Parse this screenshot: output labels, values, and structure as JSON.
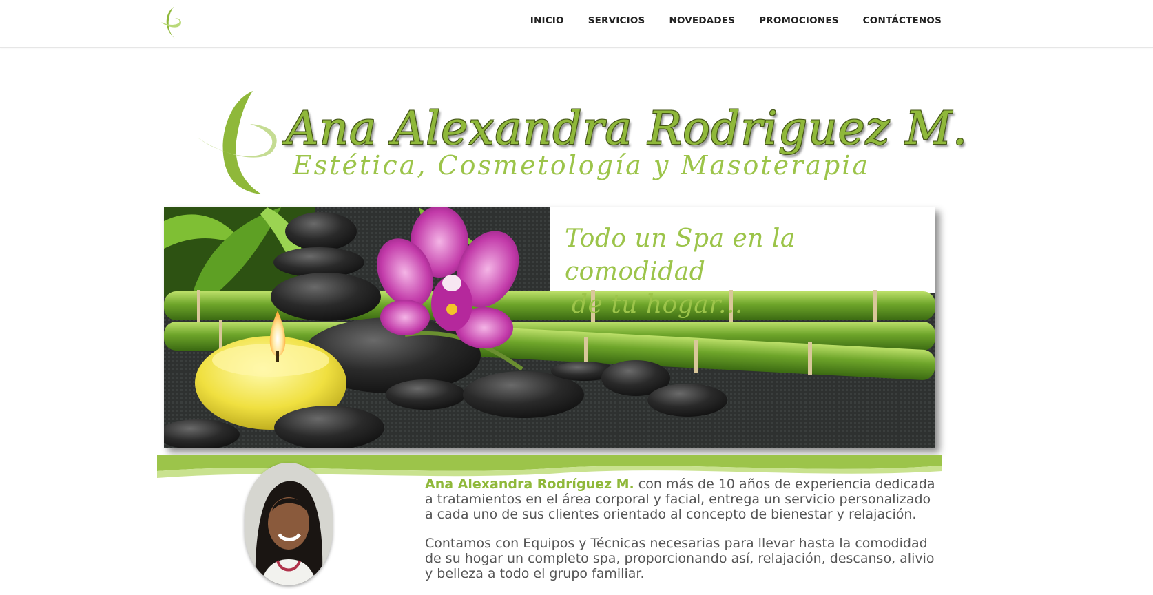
{
  "nav": {
    "items": [
      "INICIO",
      "SERVICIOS",
      "NOVEDADES",
      "PROMOCIONES",
      "CONTÁCTENOS"
    ]
  },
  "brand": {
    "name": "Ana Alexandra Rodriguez M.",
    "tagline": "Estética, Cosmetología y Masoterapia"
  },
  "banner": {
    "quote_line1": "Todo un Spa en la comodidad",
    "quote_line2": "de tu hogar..."
  },
  "about": {
    "name_highlight": "Ana Alexandra Rodríguez M.",
    "paragraph1_rest": " con más de 10 años de experiencia dedicada a tratamientos en el área corporal y facial, entrega un servicio personalizado a cada uno de sus clientes orientado al concepto de bienestar y relajación.",
    "paragraph2": "Contamos con Equipos y Técnicas necesarias para llevar hasta la comodidad de su hogar un completo spa, proporcionando así, relajación, descanso, alivio y belleza a todo el grupo familiar."
  },
  "icons": {
    "logo": "leaf-swirl-logo-icon"
  },
  "colors": {
    "accent": "#8fb83a",
    "accent_light": "#b9d97a",
    "text": "#555555",
    "nav_text": "#222222"
  }
}
